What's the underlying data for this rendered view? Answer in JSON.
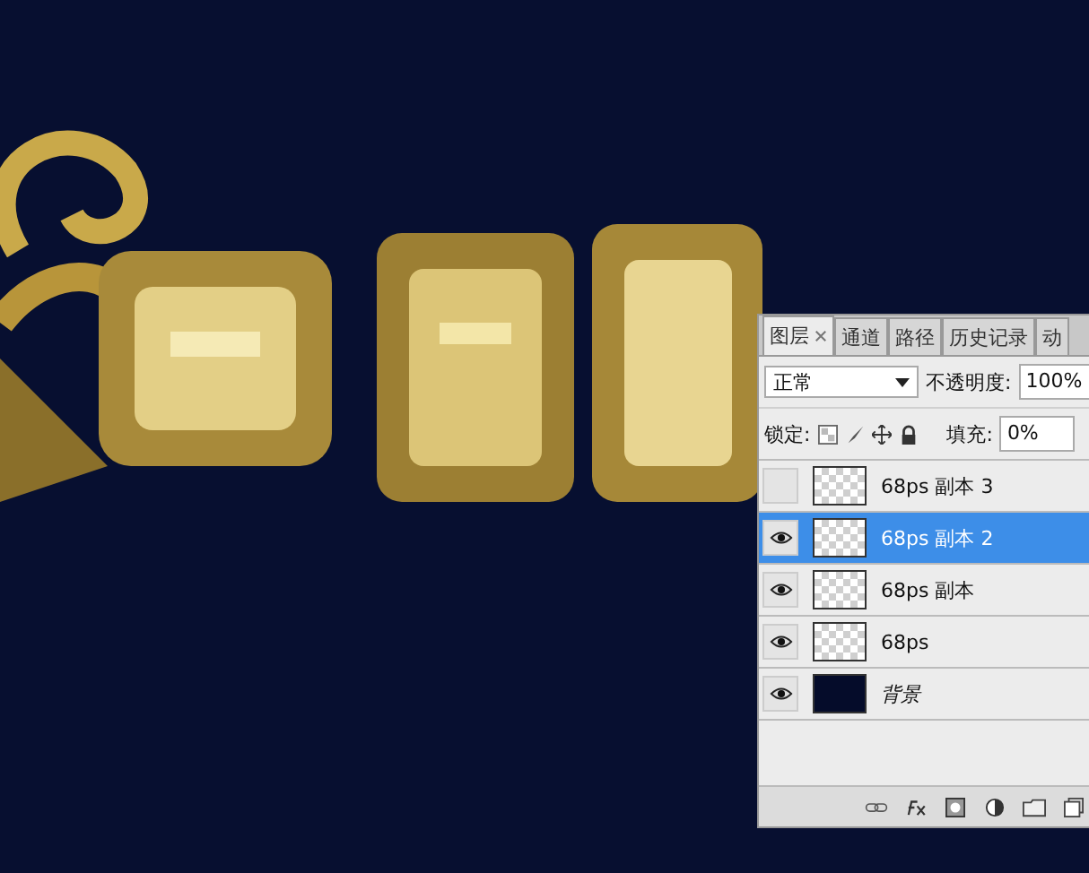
{
  "layers_panel": {
    "tabs": [
      {
        "label": "图层",
        "selected": true,
        "closable": true
      },
      {
        "label": "通道",
        "selected": false,
        "closable": false
      },
      {
        "label": "路径",
        "selected": false,
        "closable": false
      },
      {
        "label": "历史记录",
        "selected": false,
        "closable": false
      },
      {
        "label": "动",
        "selected": false,
        "closable": false
      }
    ],
    "blend_mode": "正常",
    "opacity_label": "不透明度:",
    "opacity": "100%",
    "lock_label": "锁定:",
    "fill_label": "填充:",
    "fill": "0%",
    "layers": [
      {
        "name": "68ps 副本 3",
        "visible": false,
        "selected": false,
        "kind": "transparent"
      },
      {
        "name": "68ps 副本 2",
        "visible": true,
        "selected": true,
        "kind": "transparent"
      },
      {
        "name": "68ps  副本",
        "visible": true,
        "selected": false,
        "kind": "transparent"
      },
      {
        "name": "68ps",
        "visible": true,
        "selected": false,
        "kind": "transparent"
      },
      {
        "name": "背景",
        "visible": true,
        "selected": false,
        "kind": "background"
      }
    ]
  }
}
